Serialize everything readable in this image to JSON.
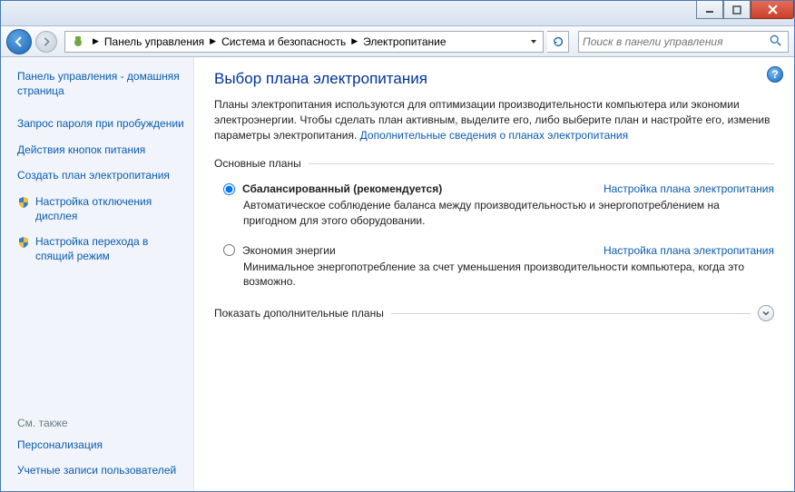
{
  "window": {
    "minimize": "–",
    "maximize": "▢",
    "close": "✕"
  },
  "breadcrumb": {
    "item0": "Панель управления",
    "item1": "Система и безопасность",
    "item2": "Электропитание"
  },
  "search": {
    "placeholder": "Поиск в панели управления"
  },
  "sidebar": {
    "home": "Панель управления - домашняя страница",
    "link0": "Запрос пароля при пробуждении",
    "link1": "Действия кнопок питания",
    "link2": "Создать план электропитания",
    "link3": "Настройка отключения дисплея",
    "link4": "Настройка перехода в спящий режим",
    "see_also": "См. также",
    "rel0": "Персонализация",
    "rel1": "Учетные записи пользователей"
  },
  "main": {
    "title": "Выбор плана электропитания",
    "intro_text": "Планы электропитания используются для оптимизации производительности компьютера или экономии электроэнергии. Чтобы сделать план активным, выделите его, либо выберите план и настройте его, изменив параметры электропитания. ",
    "intro_link": "Дополнительные сведения о планах электропитания",
    "section_basic": "Основные планы",
    "section_extra": "Показать дополнительные планы",
    "setup_link": "Настройка плана электропитания",
    "plan0": {
      "title": "Сбалансированный (рекомендуется)",
      "desc": "Автоматическое соблюдение баланса между производительностью и энергопотреблением на пригодном для этого оборудовании."
    },
    "plan1": {
      "title": "Экономия энергии",
      "desc": "Минимальное энергопотребление за счет уменьшения производительности компьютера, когда это возможно."
    }
  }
}
